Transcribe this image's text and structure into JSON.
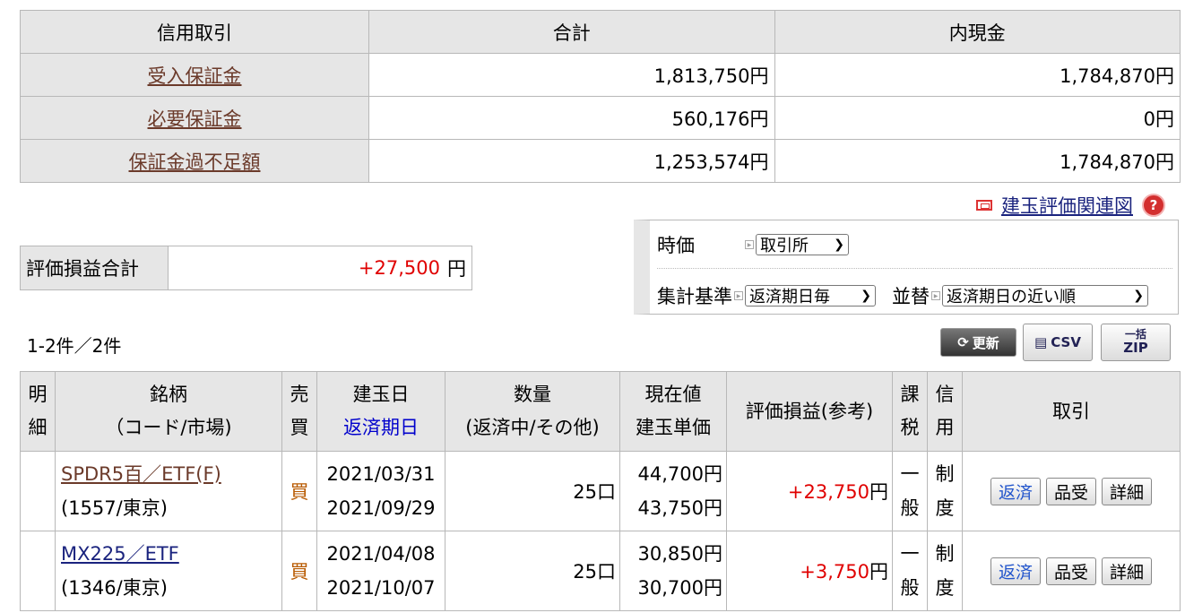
{
  "margin": {
    "headers": [
      "信用取引",
      "合計",
      "内現金"
    ],
    "rows": [
      {
        "label": "受入保証金",
        "total": "1,813,750円",
        "cash": "1,784,870円"
      },
      {
        "label": "必要保証金",
        "total": "560,176円",
        "cash": "0円"
      },
      {
        "label": "保証金過不足額",
        "total": "1,253,574円",
        "cash": "1,784,870円"
      }
    ]
  },
  "related_link": "建玉評価関連図",
  "help_icon": "?",
  "pl_total": {
    "label": "評価損益合計",
    "value": "+27,500",
    "unit": "円"
  },
  "options": {
    "price_label": "時価",
    "price_value": "取引所",
    "agg_label": "集計基準",
    "agg_value": "返済期日毎",
    "sort_label": "並替",
    "sort_value": "返済期日の近い順"
  },
  "count": "1-2件／2件",
  "toolbar": {
    "refresh": "更新",
    "csv": "CSV",
    "zip_top": "一括",
    "zip": "ZIP"
  },
  "table": {
    "h_detail_1": "明",
    "h_detail_2": "細",
    "h_name_1": "銘柄",
    "h_name_2": "（コード/市場)",
    "h_side_1": "売",
    "h_side_2": "買",
    "h_date_1": "建玉日",
    "h_date_2": "返済期日",
    "h_qty_1": "数量",
    "h_qty_2": "(返済中/その他)",
    "h_price_1": "現在値",
    "h_price_2": "建玉単価",
    "h_pl": "評価損益(参考)",
    "h_tax_1": "課",
    "h_tax_2": "税",
    "h_credit_1": "信",
    "h_credit_2": "用",
    "h_trade": "取引",
    "rows": [
      {
        "name": "SPDR5百／ETF(F)",
        "code": "(1557/東京)",
        "side": "買",
        "date": "2021/03/31",
        "due": "2021/09/29",
        "qty": "25口",
        "price": "44,700円",
        "unit_price": "43,750円",
        "pl": "+23,750",
        "pl_unit": "円",
        "tax_1": "一",
        "tax_2": "般",
        "credit_1": "制",
        "credit_2": "度",
        "btn_return": "返済",
        "btn_receive": "品受",
        "btn_detail": "詳細"
      },
      {
        "name": "MX225／ETF",
        "code": "(1346/東京)",
        "side": "買",
        "date": "2021/04/08",
        "due": "2021/10/07",
        "qty": "25口",
        "price": "30,850円",
        "unit_price": "30,700円",
        "pl": "+3,750",
        "pl_unit": "円",
        "tax_1": "一",
        "tax_2": "般",
        "credit_1": "制",
        "credit_2": "度",
        "btn_return": "返済",
        "btn_receive": "品受",
        "btn_detail": "詳細"
      }
    ]
  }
}
